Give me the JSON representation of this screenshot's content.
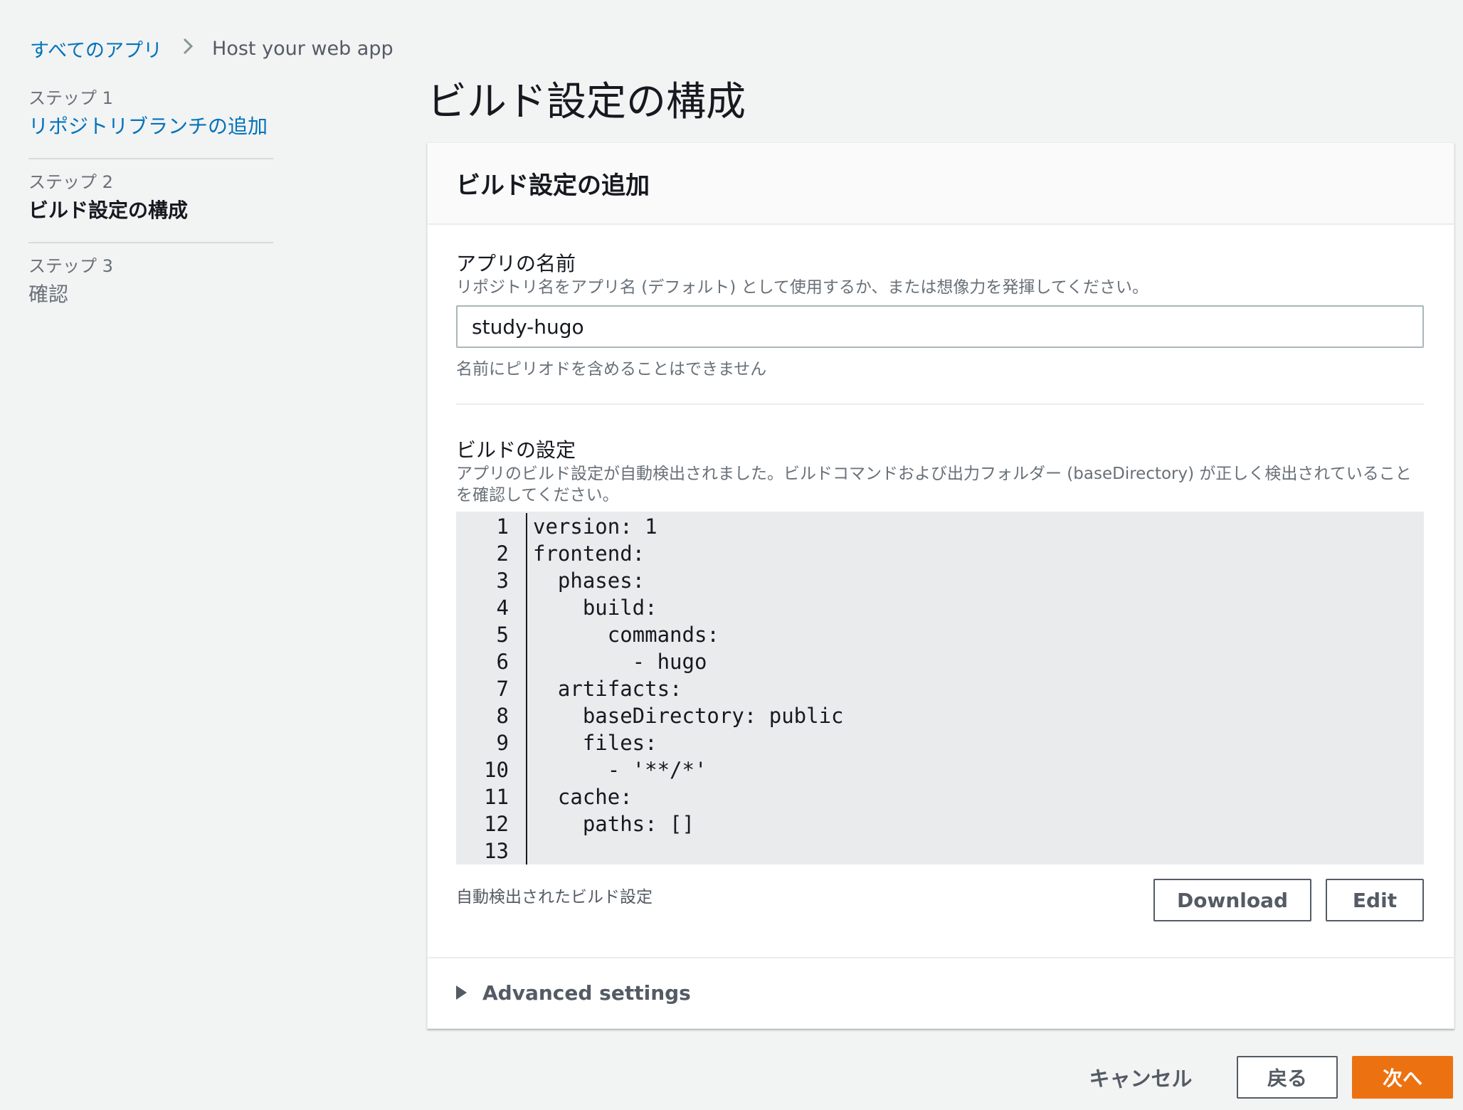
{
  "breadcrumb": {
    "root_label": "すべてのアプリ",
    "separator": ">",
    "current_label": "Host your web app"
  },
  "steps": [
    {
      "num": "ステップ 1",
      "title": "リポジトリブランチの追加",
      "state": "link"
    },
    {
      "num": "ステップ 2",
      "title": "ビルド設定の構成",
      "state": "active"
    },
    {
      "num": "ステップ 3",
      "title": "確認",
      "state": "disabled"
    }
  ],
  "page_title": "ビルド設定の構成",
  "panel": {
    "title": "ビルド設定の追加",
    "app_name": {
      "label": "アプリの名前",
      "description": "リポジトリ名をアプリ名 (デフォルト) として使用するか、または想像力を発揮してください。",
      "value": "study-hugo",
      "hint": "名前にピリオドを含めることはできません"
    },
    "build_settings": {
      "label": "ビルドの設定",
      "description": "アプリのビルド設定が自動検出されました。ビルドコマンドおよび出力フォルダー (baseDirectory) が正しく検出されていることを確認してください。",
      "code_lines": [
        "version: 1",
        "frontend:",
        "  phases:",
        "    build:",
        "      commands:",
        "        - hugo",
        "  artifacts:",
        "    baseDirectory: public",
        "    files:",
        "      - '**/*'",
        "  cache:",
        "    paths: []",
        ""
      ],
      "caption": "自動検出されたビルド設定",
      "download_label": "Download",
      "edit_label": "Edit"
    },
    "advanced_label": "Advanced settings"
  },
  "footer": {
    "cancel_label": "キャンセル",
    "back_label": "戻る",
    "next_label": "次へ"
  },
  "colors": {
    "link": "#0073bb",
    "primary_button": "#ec7211",
    "background": "#f2f3f3"
  }
}
